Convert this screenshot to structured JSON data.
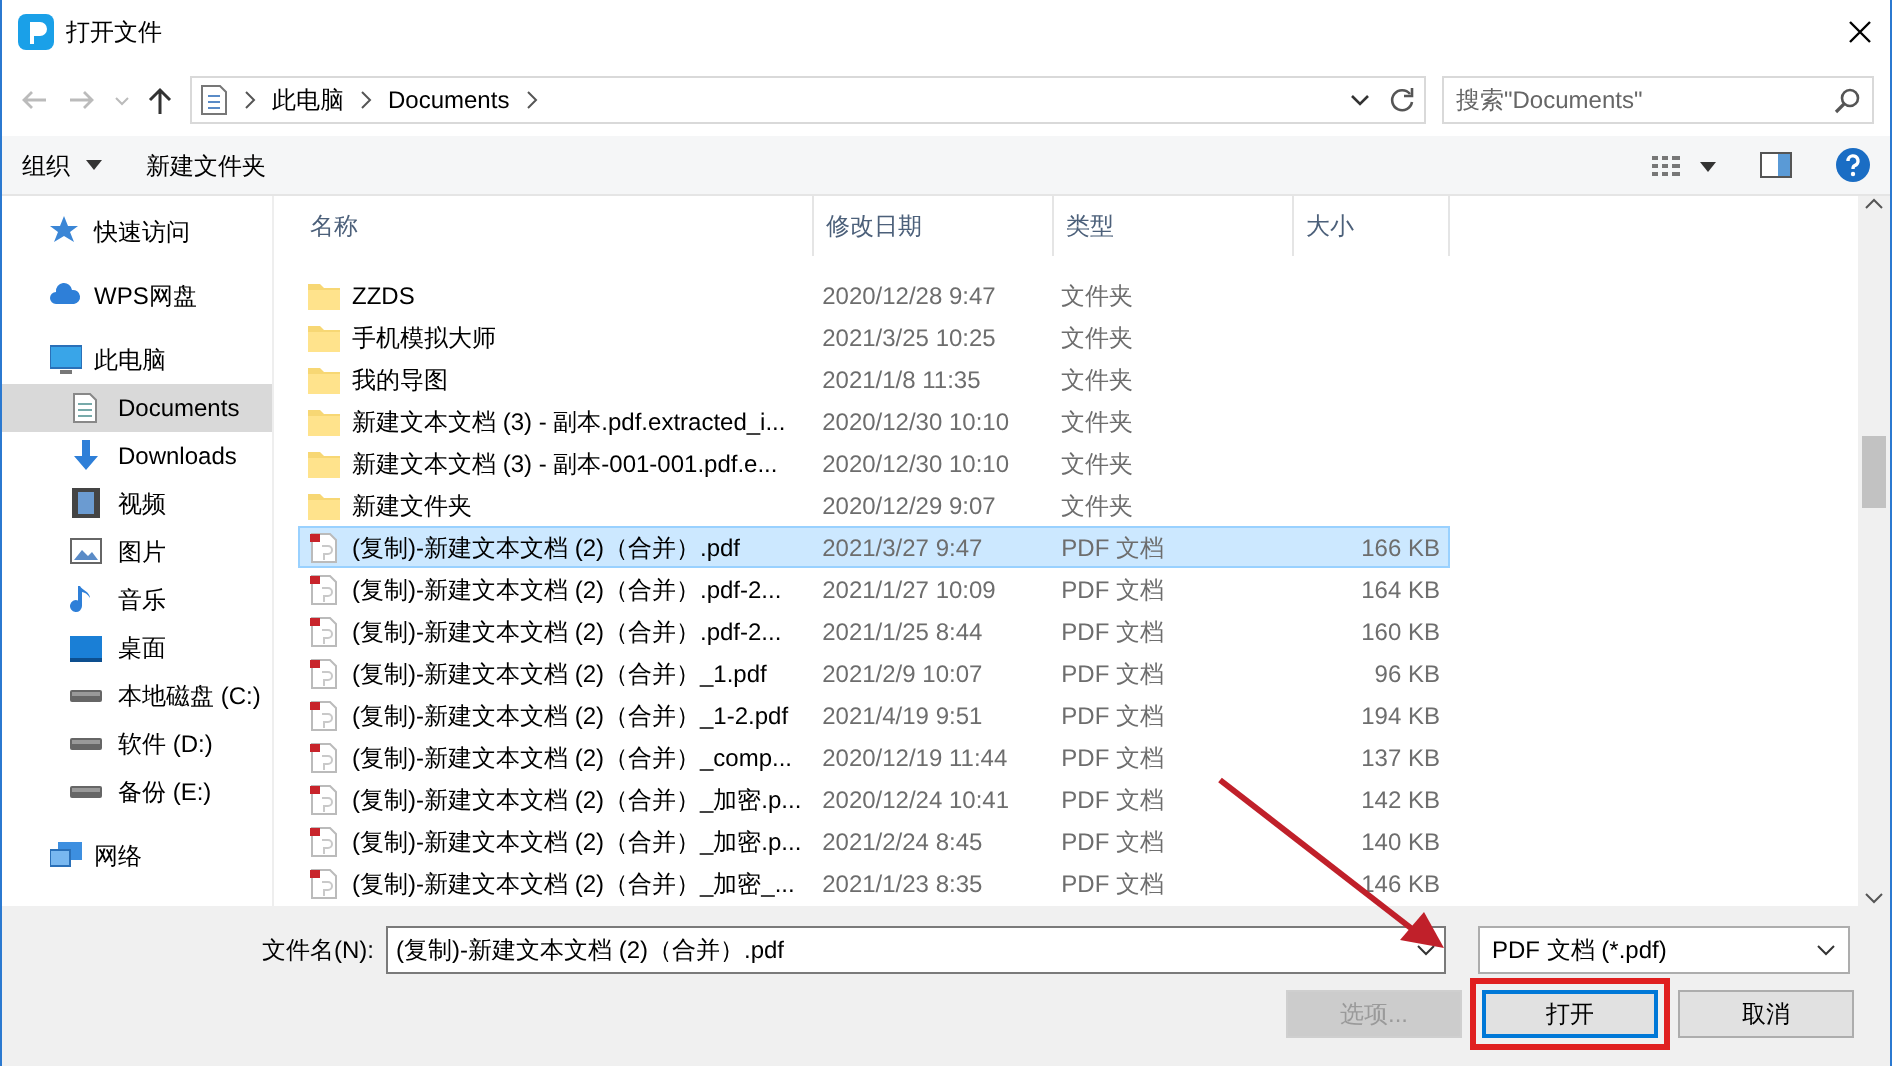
{
  "window": {
    "title": "打开文件"
  },
  "address": {
    "path": [
      "此电脑",
      "Documents"
    ],
    "search_placeholder": "搜索\"Documents\""
  },
  "toolbar": {
    "organize": "组织",
    "new_folder": "新建文件夹"
  },
  "sidebar": {
    "items": [
      {
        "label": "快速访问",
        "kind": "star",
        "selected": false
      },
      {
        "label": "WPS网盘",
        "kind": "cloud",
        "selected": false
      },
      {
        "label": "此电脑",
        "kind": "monitor",
        "selected": false,
        "children": [
          {
            "label": "Documents",
            "kind": "document",
            "selected": true
          },
          {
            "label": "Downloads",
            "kind": "download",
            "selected": false
          },
          {
            "label": "视频",
            "kind": "film",
            "selected": false
          },
          {
            "label": "图片",
            "kind": "picture",
            "selected": false
          },
          {
            "label": "音乐",
            "kind": "note",
            "selected": false
          },
          {
            "label": "桌面",
            "kind": "desktop",
            "selected": false
          },
          {
            "label": "本地磁盘 (C:)",
            "kind": "drive",
            "selected": false
          },
          {
            "label": "软件 (D:)",
            "kind": "drive",
            "selected": false
          },
          {
            "label": "备份 (E:)",
            "kind": "drive",
            "selected": false
          }
        ]
      },
      {
        "label": "网络",
        "kind": "network",
        "selected": false
      }
    ]
  },
  "table": {
    "columns": [
      "名称",
      "修改日期",
      "类型",
      "大小"
    ],
    "rows": [
      {
        "kind": "folder",
        "name": "ZZDS",
        "date": "2020/12/28 9:47",
        "type": "文件夹",
        "selected": false
      },
      {
        "kind": "folder",
        "name": "手机模拟大师",
        "date": "2021/3/25 10:25",
        "type": "文件夹",
        "selected": false
      },
      {
        "kind": "folder",
        "name": "我的导图",
        "date": "2021/1/8 11:35",
        "type": "文件夹",
        "selected": false
      },
      {
        "kind": "folder",
        "name": "新建文本文档 (3) - 副本.pdf.extracted_i...",
        "date": "2020/12/30 10:10",
        "type": "文件夹",
        "selected": false
      },
      {
        "kind": "folder",
        "name": "新建文本文档 (3) - 副本-001-001.pdf.e...",
        "date": "2020/12/30 10:10",
        "type": "文件夹",
        "selected": false
      },
      {
        "kind": "folder",
        "name": "新建文件夹",
        "date": "2020/12/29 9:07",
        "type": "文件夹",
        "selected": false
      },
      {
        "kind": "pdf",
        "name": "(复制)-新建文本文档 (2)（合并）.pdf",
        "date": "2021/3/27 9:47",
        "type": "PDF 文档",
        "size": "166 KB",
        "selected": true
      },
      {
        "kind": "pdf",
        "name": "(复制)-新建文本文档 (2)（合并）.pdf-2...",
        "date": "2021/1/27 10:09",
        "type": "PDF 文档",
        "size": "164 KB",
        "selected": false
      },
      {
        "kind": "pdf",
        "name": "(复制)-新建文本文档 (2)（合并）.pdf-2...",
        "date": "2021/1/25 8:44",
        "type": "PDF 文档",
        "size": "160 KB",
        "selected": false
      },
      {
        "kind": "pdf",
        "name": "(复制)-新建文本文档 (2)（合并）_1.pdf",
        "date": "2021/2/9 10:07",
        "type": "PDF 文档",
        "size": "96 KB",
        "selected": false
      },
      {
        "kind": "pdf",
        "name": "(复制)-新建文本文档 (2)（合并）_1-2.pdf",
        "date": "2021/4/19 9:51",
        "type": "PDF 文档",
        "size": "194 KB",
        "selected": false
      },
      {
        "kind": "pdf",
        "name": "(复制)-新建文本文档 (2)（合并）_comp...",
        "date": "2020/12/19 11:44",
        "type": "PDF 文档",
        "size": "137 KB",
        "selected": false
      },
      {
        "kind": "pdf",
        "name": "(复制)-新建文本文档 (2)（合并）_加密.p...",
        "date": "2020/12/24 10:41",
        "type": "PDF 文档",
        "size": "142 KB",
        "selected": false
      },
      {
        "kind": "pdf",
        "name": "(复制)-新建文本文档 (2)（合并）_加密.p...",
        "date": "2021/2/24 8:45",
        "type": "PDF 文档",
        "size": "140 KB",
        "selected": false
      },
      {
        "kind": "pdf",
        "name": "(复制)-新建文本文档 (2)（合并）_加密_...",
        "date": "2021/1/23 8:35",
        "type": "PDF 文档",
        "size": "146 KB",
        "selected": false
      }
    ]
  },
  "footer": {
    "filename_label": "文件名(N):",
    "filename": "(复制)-新建文本文档 (2)（合并）.pdf",
    "filter": "PDF 文档 (*.pdf)",
    "buttons": [
      {
        "label": "选项...",
        "disabled": true,
        "highlighted": false
      },
      {
        "label": "打开",
        "disabled": false,
        "highlighted": true
      },
      {
        "label": "取消",
        "disabled": false,
        "highlighted": false
      }
    ]
  }
}
